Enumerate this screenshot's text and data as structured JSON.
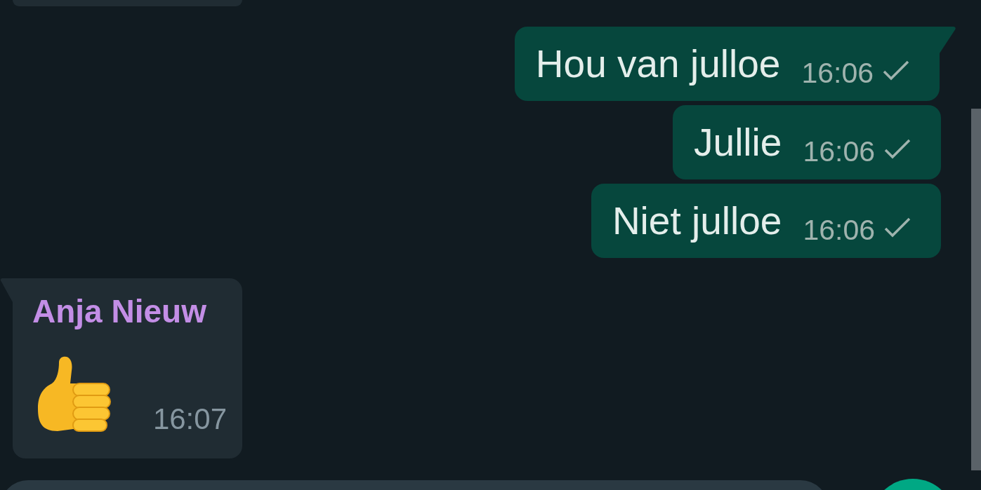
{
  "messages": [
    {
      "outgoing": true,
      "kind": "text",
      "tail": true,
      "text": "Hou van julloe",
      "time": "16:06",
      "read": false
    },
    {
      "outgoing": true,
      "kind": "text",
      "tail": false,
      "text": "Jullie",
      "time": "16:06",
      "read": false
    },
    {
      "outgoing": true,
      "kind": "text",
      "tail": false,
      "text": "Niet julloe",
      "time": "16:06",
      "read": false
    },
    {
      "outgoing": false,
      "kind": "emoji",
      "tail": true,
      "sender": "Anja Nieuw",
      "color": "#c38ee6",
      "time": "16:07"
    }
  ]
}
